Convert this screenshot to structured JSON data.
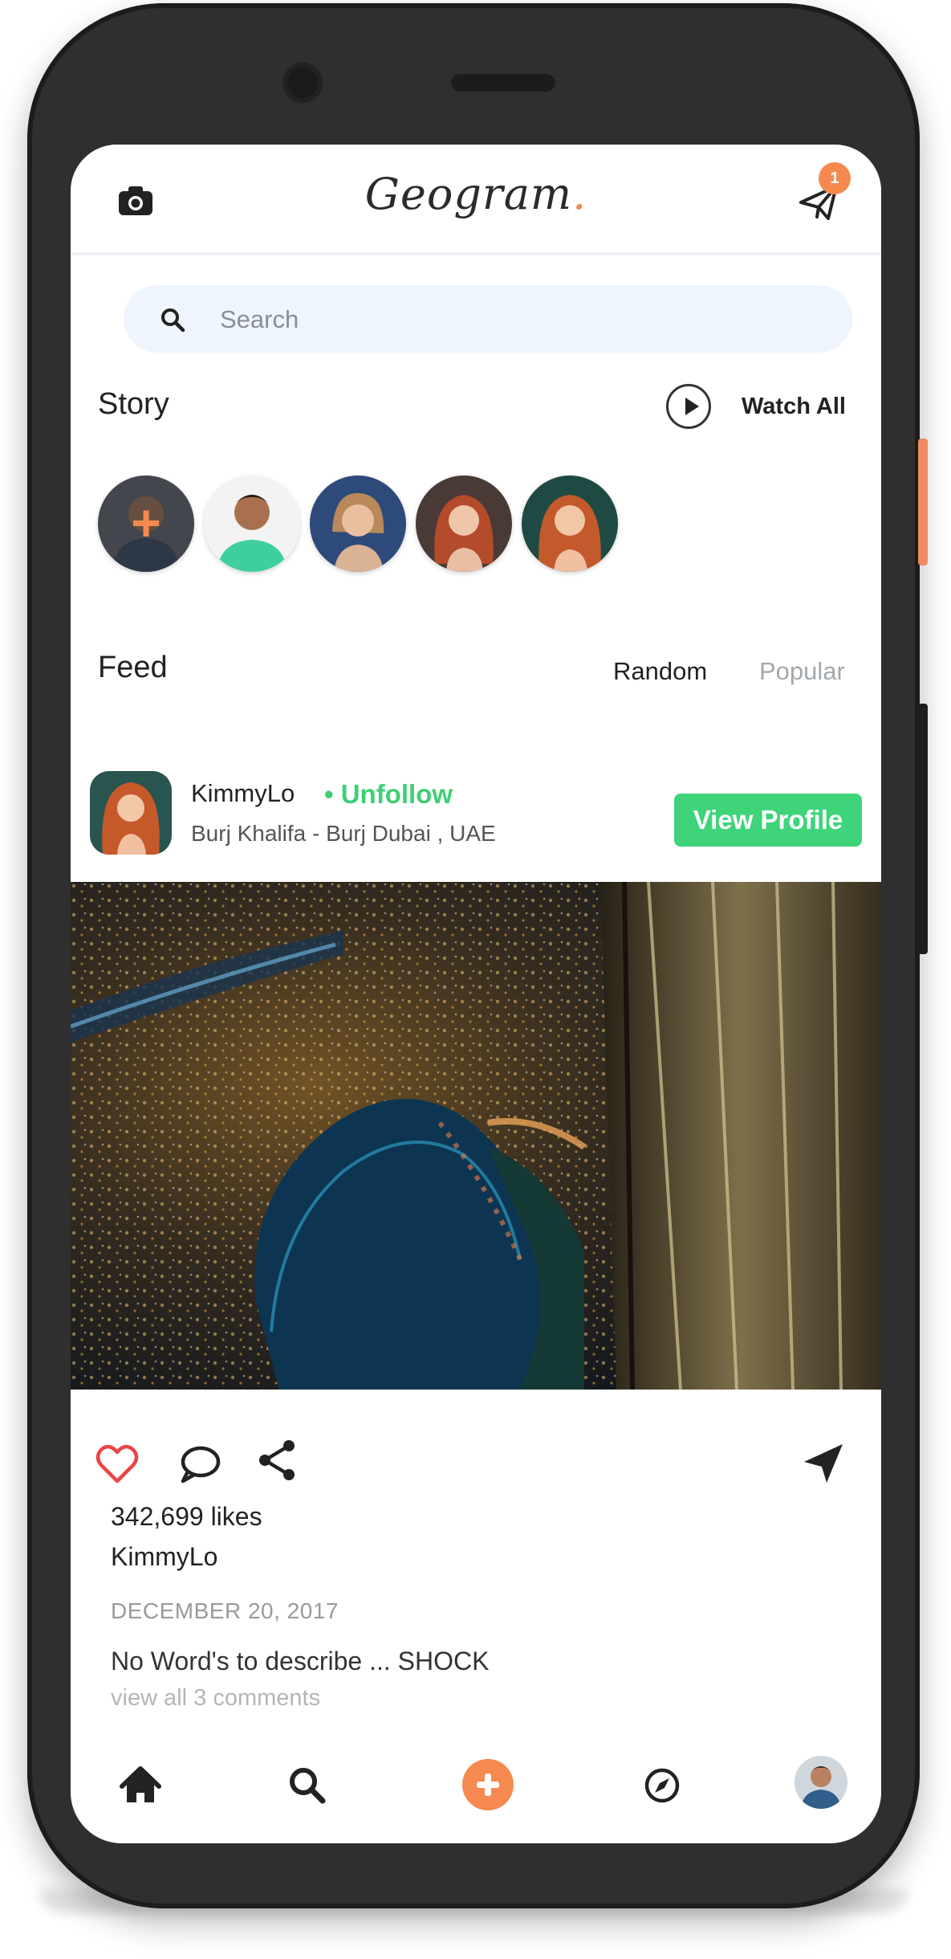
{
  "header": {
    "brand": "Geogram",
    "brand_dot": ".",
    "notification_count": "1"
  },
  "search": {
    "placeholder": "Search"
  },
  "story": {
    "title": "Story",
    "watch_all": "Watch All",
    "items": [
      {
        "kind": "add-story"
      },
      {
        "kind": "story"
      },
      {
        "kind": "story"
      },
      {
        "kind": "story"
      },
      {
        "kind": "story"
      }
    ]
  },
  "feed": {
    "title": "Feed",
    "tabs": [
      {
        "label": "Random",
        "active": true
      },
      {
        "label": "Popular",
        "active": false
      }
    ]
  },
  "post": {
    "username": "KimmyLo",
    "follow_action": "• Unfollow",
    "location": "Burj Khalifa - Burj Dubai , UAE",
    "view_profile": "View Profile",
    "likes": "342,699 likes",
    "author": "KimmyLo",
    "date": "DECEMBER 20, 2017",
    "caption": "No Word's to describe ... SHOCK",
    "view_comments": "view all 3 comments",
    "liked": true
  },
  "nav": {
    "items": [
      "home-icon",
      "search-icon",
      "add-icon",
      "compass-icon",
      "profile-avatar"
    ]
  },
  "colors": {
    "accent": "#f5894f",
    "success": "#3fd47a",
    "like": "#e94545",
    "search_bg": "#eef5fc"
  }
}
